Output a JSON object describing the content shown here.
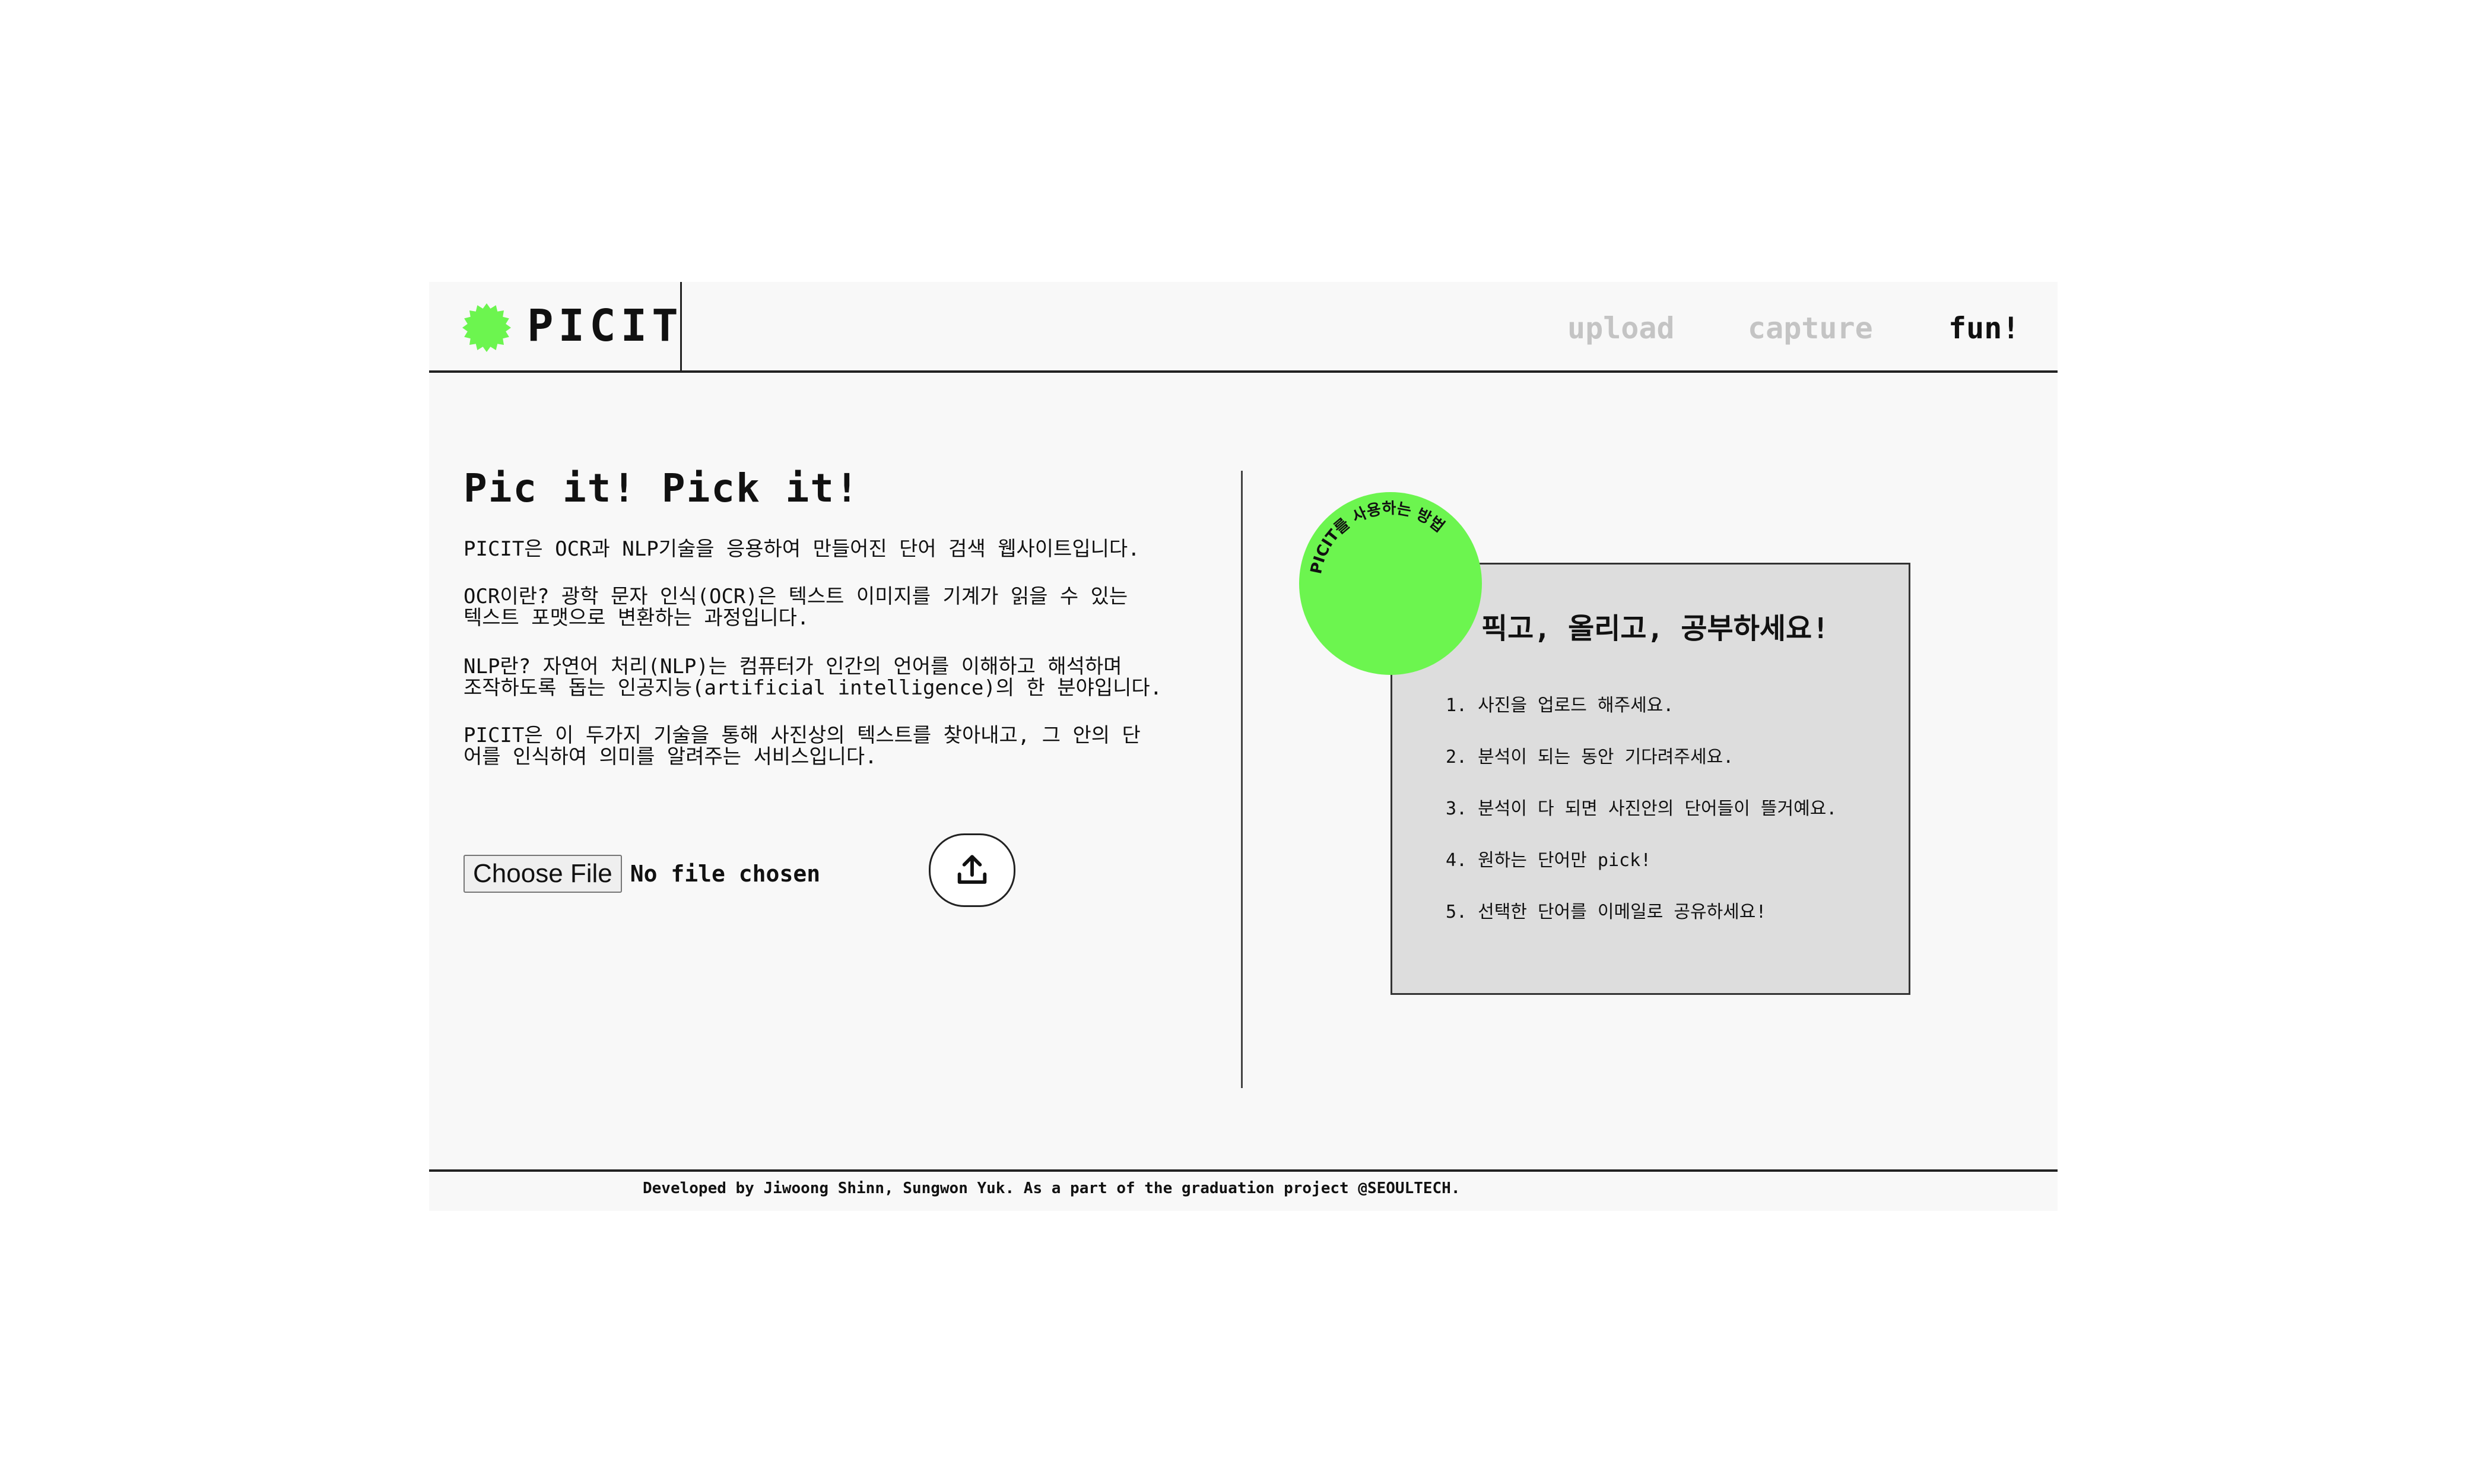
{
  "header": {
    "logo_text": "PICIT",
    "brand_color": "#6cf54f",
    "nav": {
      "upload": "upload",
      "capture": "capture",
      "fun": "fun!"
    },
    "active_nav": "fun!"
  },
  "main": {
    "headline": "Pic it! Pick it!",
    "paragraphs": [
      "PICIT은 OCR과 NLP기술을 응용하여 만들어진 단어 검색 웹사이트입니다.",
      "OCR이란? 광학 문자 인식(OCR)은 텍스트 이미지를 기계가 읽을 수 있는\n텍스트 포맷으로 변환하는 과정입니다.",
      "NLP란? 자연어 처리(NLP)는 컴퓨터가 인간의 언어를 이해하고 해석하며\n조작하도록 돕는 인공지능(artificial intelligence)의 한 분야입니다.",
      "PICIT은 이 두가지 기술을 통해 사진상의 텍스트를 찾아내고, 그 안의 단\n어를 인식하여 의미를 알려주는 서비스입니다."
    ],
    "file_input": {
      "button_label": "Choose File",
      "status": "No file chosen"
    },
    "upload_icon": "upload-icon"
  },
  "guide": {
    "badge_text": "PICIT를 사용하는 방법",
    "title": "픽고, 올리고, 공부하세요!",
    "steps": [
      "1. 사진을 업로드 해주세요.",
      "2. 분석이 되는 동안 기다려주세요.",
      "3. 분석이 다 되면 사진안의 단어들이 뜰거예요.",
      "4. 원하는 단어만 pick!",
      "5. 선택한 단어를 이메일로 공유하세요!"
    ]
  },
  "footer": {
    "text": "Developed by Jiwoong Shinn, Sungwon Yuk. As a part of the graduation project @SEOULTECH."
  }
}
